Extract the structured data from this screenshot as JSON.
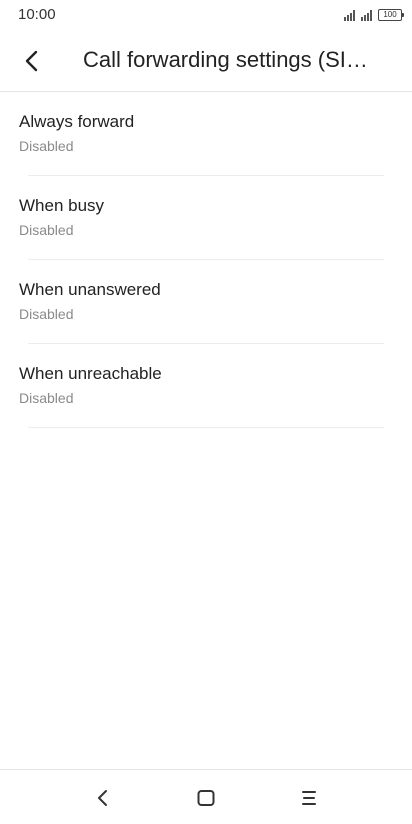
{
  "status_bar": {
    "time": "10:00",
    "battery": "100",
    "icons": [
      "signal-icon",
      "signal-icon",
      "battery-icon"
    ]
  },
  "app_bar": {
    "back_icon": "back-arrow-icon",
    "title": "Call forwarding settings (SI…"
  },
  "list": {
    "items": [
      {
        "title": "Always forward",
        "status": "Disabled"
      },
      {
        "title": "When busy",
        "status": "Disabled"
      },
      {
        "title": "When unanswered",
        "status": "Disabled"
      },
      {
        "title": "When unreachable",
        "status": "Disabled"
      }
    ]
  },
  "nav_bar": {
    "icons": [
      "nav-back-icon",
      "nav-home-icon",
      "nav-menu-icon"
    ]
  }
}
